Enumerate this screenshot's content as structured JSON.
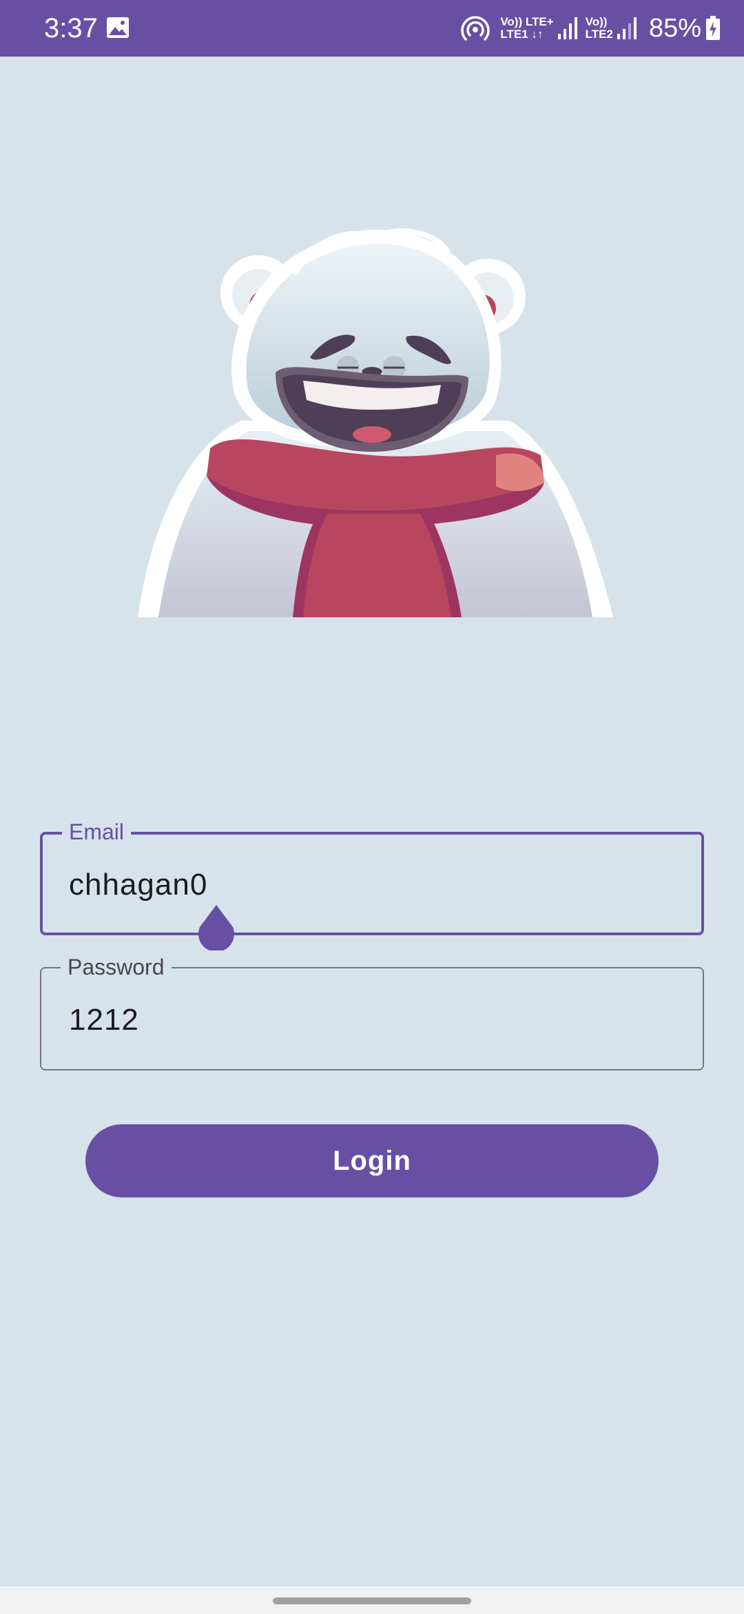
{
  "status_bar": {
    "time": "3:37",
    "sim1_top": "Vo)) LTE+",
    "sim1_bottom": "LTE1 ↓↑",
    "sim2_top": "Vo))",
    "sim2_bottom": "LTE2",
    "battery": "85%",
    "icons": [
      "gallery-icon",
      "hotspot-icon",
      "signal-icon",
      "battery-charging-icon"
    ]
  },
  "mascot": {
    "icon": "polar-bear-mascot",
    "colors": {
      "fur": "#e4eef3",
      "scarf": "#b8465f",
      "mouth": "#4f3e57"
    }
  },
  "form": {
    "email": {
      "label": "Email",
      "value": "chhagan0"
    },
    "password": {
      "label": "Password",
      "value": "1212"
    },
    "login_label": "Login"
  },
  "theme": {
    "primary": "#6750a4",
    "background": "#d7e3ea",
    "outline": "#79747e"
  }
}
